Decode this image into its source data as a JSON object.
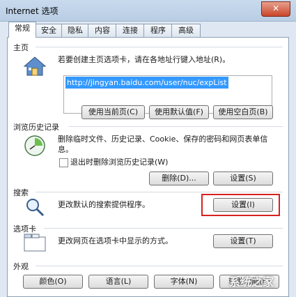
{
  "window": {
    "title": "Internet 选项",
    "close_glyph": "✕"
  },
  "tabs": [
    "常规",
    "安全",
    "隐私",
    "内容",
    "连接",
    "程序",
    "高级"
  ],
  "home": {
    "label": "主页",
    "description": "若要创建主页选项卡，请在各地址行键入地址(R)。",
    "url": "http://jingyan.baidu.com/user/nuc/expList",
    "buttons": [
      "使用当前页(C)",
      "使用默认值(F)",
      "使用空白页(B)"
    ]
  },
  "history": {
    "label": "浏览历史记录",
    "description": "删除临时文件、历史记录、Cookie、保存的密码和网页表单信息。",
    "checkbox_label": "退出时删除浏览历史记录(W)",
    "checkbox_checked": false,
    "buttons": [
      "删除(D)...",
      "设置(S)"
    ]
  },
  "search": {
    "label": "搜索",
    "description": "更改默认的搜索提供程序。",
    "button": "设置(I)"
  },
  "tabs_section": {
    "label": "选项卡",
    "description": "更改网页在选项卡中显示的方式。",
    "button": "设置(T)"
  },
  "appearance": {
    "label": "外观",
    "buttons": [
      "颜色(O)",
      "语言(L)",
      "字体(N)",
      "辅助功能(E)"
    ]
  },
  "watermark": "系统之家",
  "highlight_color": "#d9201f"
}
